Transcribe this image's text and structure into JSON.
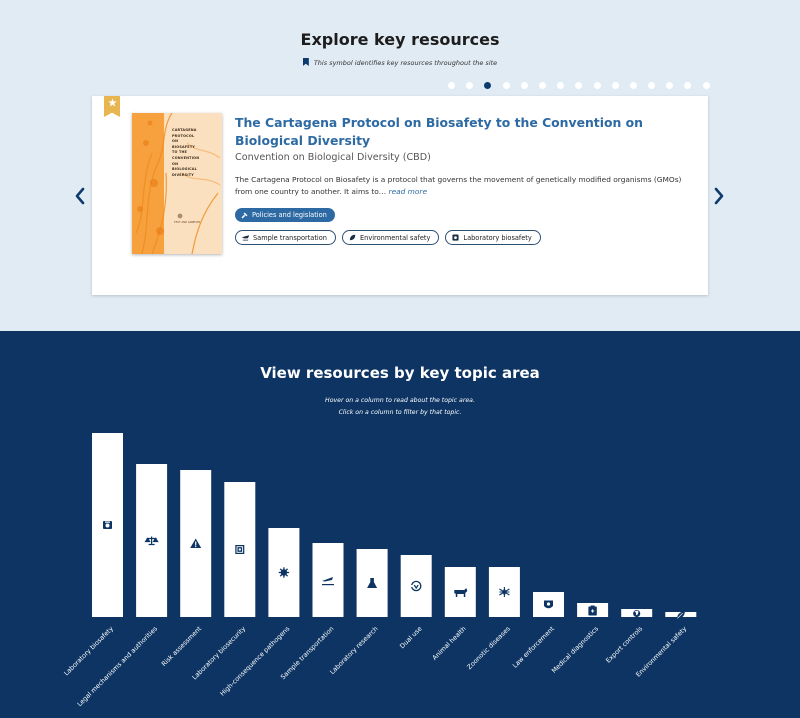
{
  "top": {
    "title": "Explore key resources",
    "symbol_note": "This symbol identifies key resources throughout the site",
    "carousel": {
      "slide_count": 15,
      "active_index": 2
    },
    "resource": {
      "title": "The Cartagena Protocol on Biosafety to the Convention on Biological Diversity",
      "organization": "Convention on Biological Diversity (CBD)",
      "description": "The Cartagena Protocol on Biosafety is a protocol that governs the movement of genetically modified organisms (GMOs) from one country to another. It aims to…",
      "read_more": "read more",
      "cover_lines": [
        "CARTAGENA",
        "PROTOCOL",
        "ON",
        "BIOSAFETY",
        "TO THE",
        "CONVENTION",
        "ON",
        "BIOLOGICAL",
        "DIVERSITY"
      ],
      "cover_subtitle": "TEXT AND ANNEXES",
      "primary_tag": "Policies and legislation",
      "tags": [
        "Sample transportation",
        "Environmental safety",
        "Laboratory biosafety"
      ]
    }
  },
  "bottom": {
    "title": "View resources by key topic area",
    "hint1": "Hover on a column to read about the topic area.",
    "hint2": "Click on a column to filter by that topic."
  },
  "colors": {
    "navy": "#0d3463",
    "link": "#2d6aa3",
    "ribbon": "#e8b650",
    "bg": "#e1ebf4"
  },
  "chart_data": {
    "type": "bar",
    "categories": [
      "Laboratory biosafety",
      "Legal mechanisms and authorities",
      "Risk assessment",
      "Laboratory biosecurity",
      "High-consequence pathogens",
      "Sample transportation",
      "Laboratory research",
      "Dual use",
      "Animal health",
      "Zoonotic diseases",
      "Law enforcement",
      "Medical diagnostics",
      "Export controls",
      "Environmental safety"
    ],
    "values": [
      184,
      153,
      147,
      135,
      89,
      74,
      68,
      62,
      50,
      50,
      25,
      14,
      8,
      5
    ],
    "icons": [
      "lab-biosafety-icon",
      "scales-icon",
      "warning-icon",
      "biosecurity-icon",
      "pathogen-icon",
      "airplane-icon",
      "flask-icon",
      "recycle-icon",
      "cow-icon",
      "mosquito-icon",
      "badge-icon",
      "clipboard-icon",
      "globe-icon",
      "leaf-icon"
    ],
    "grid": false,
    "legend": "none"
  }
}
